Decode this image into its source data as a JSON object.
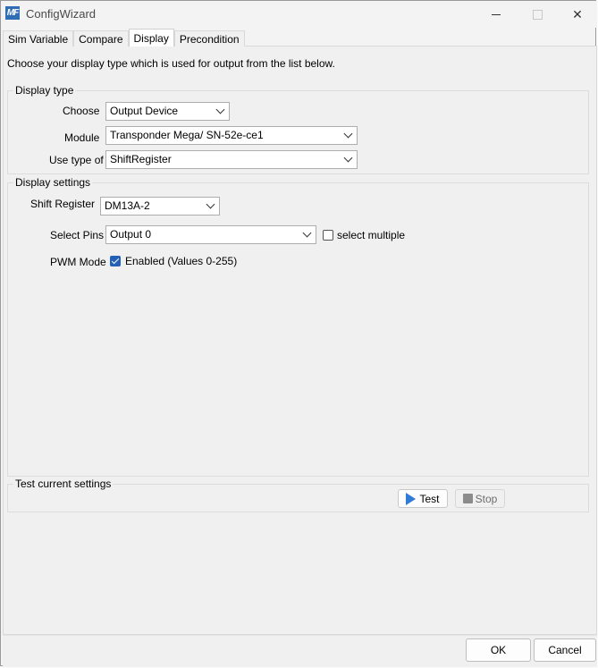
{
  "window": {
    "title": "ConfigWizard",
    "app_icon_text": "MF",
    "close_glyph": "✕"
  },
  "tabs": [
    {
      "label": "Sim Variable",
      "active": false
    },
    {
      "label": "Compare",
      "active": false
    },
    {
      "label": "Display",
      "active": true
    },
    {
      "label": "Precondition",
      "active": false
    }
  ],
  "intro": "Choose your display type which is used for output from the list below.",
  "display_type": {
    "title": "Display type",
    "choose_label": "Choose",
    "choose_value": "Output Device",
    "module_label": "Module",
    "module_value": "Transponder Mega/ SN-52e-ce1",
    "use_type_label": "Use type of",
    "use_type_value": "ShiftRegister"
  },
  "display_settings": {
    "title": "Display settings",
    "shift_register_label": "Shift Register",
    "shift_register_value": "DM13A-2",
    "select_pins_label": "Select Pins",
    "select_pins_value": "Output 0",
    "select_multiple_label": "select multiple",
    "select_multiple_checked": false,
    "pwm_label": "PWM Mode",
    "pwm_checkbox_label": "Enabled (Values 0-255)",
    "pwm_checked": true
  },
  "test": {
    "title": "Test current settings",
    "test_label": "Test",
    "stop_label": "Stop"
  },
  "footer": {
    "ok_label": "OK",
    "cancel_label": "Cancel"
  },
  "colors": {
    "accent": "#2460b8",
    "play_icon": "#2f7bd6"
  }
}
